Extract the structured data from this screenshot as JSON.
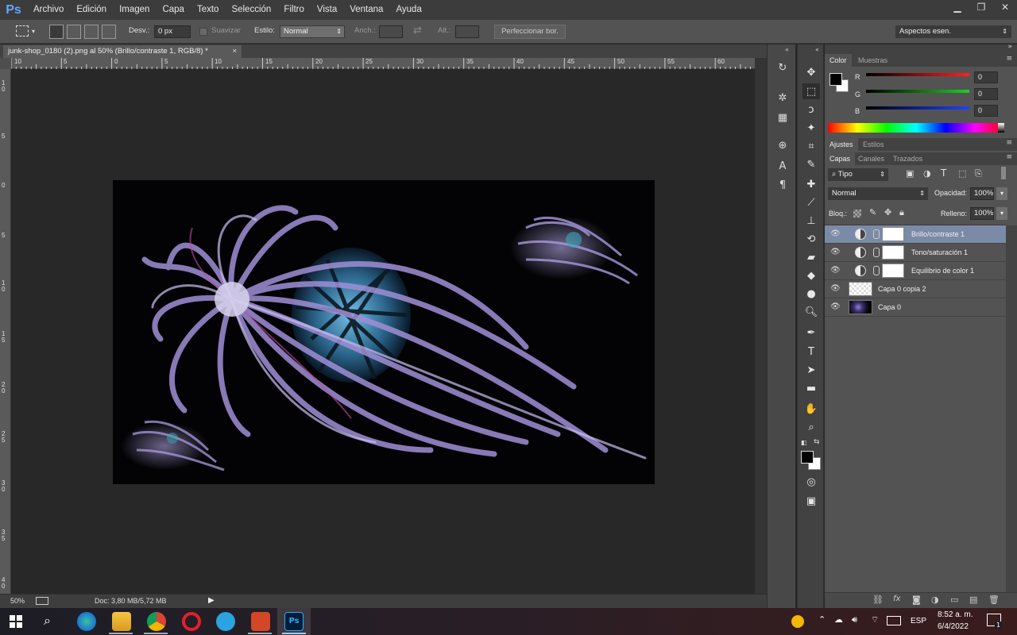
{
  "menubar": {
    "logo": "Ps",
    "items": [
      "Archivo",
      "Edición",
      "Imagen",
      "Capa",
      "Texto",
      "Selección",
      "Filtro",
      "Vista",
      "Ventana",
      "Ayuda"
    ]
  },
  "options_bar": {
    "desv_label": "Desv.:",
    "desv_value": "0 px",
    "suavizar_label": "Suavizar",
    "estilo_label": "Estilo:",
    "estilo_value": "Normal",
    "anch_label": "Anch.:",
    "alt_label": "Alt.:",
    "refine_button": "Perfeccionar bor.",
    "workspace": "Aspectos esen."
  },
  "document": {
    "tab_title": "junk-shop_0180 (2).png al 50% (Brillo/contraste 1, RGB/8) *",
    "close_glyph": "×"
  },
  "rulers": {
    "top": [
      "10",
      "5",
      "0",
      "5",
      "10",
      "15",
      "20",
      "25",
      "30",
      "35",
      "40",
      "45",
      "50",
      "55",
      "60"
    ],
    "left": [
      "1 0",
      "5",
      "0",
      "5",
      "1 0",
      "1 5",
      "2 0",
      "2 5",
      "3 0",
      "3 5",
      "4 0"
    ]
  },
  "status": {
    "zoom": "50%",
    "doc_info": "Doc: 3,80 MB/5,72 MB"
  },
  "color_panel": {
    "tabs": [
      "Color",
      "Muestras"
    ],
    "channels": [
      {
        "letter": "R",
        "value": "0",
        "color": "#ff2020"
      },
      {
        "letter": "G",
        "value": "0",
        "color": "#20d020"
      },
      {
        "letter": "B",
        "value": "0",
        "color": "#2040ff"
      }
    ]
  },
  "adjust_panel": {
    "tabs": [
      "Ajustes",
      "Estilos"
    ]
  },
  "layers_panel": {
    "tabs": [
      "Capas",
      "Canales",
      "Trazados"
    ],
    "filter_kind": "Tipo",
    "blend_mode": "Normal",
    "opacity_label": "Opacidad:",
    "opacity_value": "100%",
    "lock_label": "Bloq.:",
    "fill_label": "Relleno:",
    "fill_value": "100%",
    "layers": [
      {
        "name": "Brillo/contraste 1",
        "kind": "adjustment",
        "selected": true
      },
      {
        "name": "Tono/saturación 1",
        "kind": "adjustment",
        "selected": false
      },
      {
        "name": "Equilibrio de color 1",
        "kind": "adjustment",
        "selected": false
      },
      {
        "name": "Capa 0 copia 2",
        "kind": "transparent",
        "selected": false
      },
      {
        "name": "Capa 0",
        "kind": "image",
        "selected": false
      }
    ]
  },
  "taskbar": {
    "language": "ESP",
    "time": "8:52 a. m.",
    "date": "6/4/2022",
    "notification_count": "1"
  }
}
